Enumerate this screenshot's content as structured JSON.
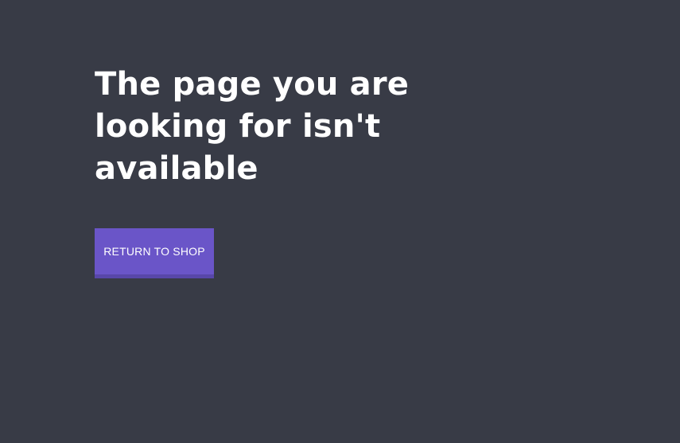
{
  "error_page": {
    "headline": "The page you are looking for isn't available",
    "return_button_label": "RETURN TO SHOP"
  },
  "colors": {
    "background": "#383b46",
    "button": "#6a55c8",
    "button_shadow": "#5847a9",
    "text": "#ffffff"
  }
}
